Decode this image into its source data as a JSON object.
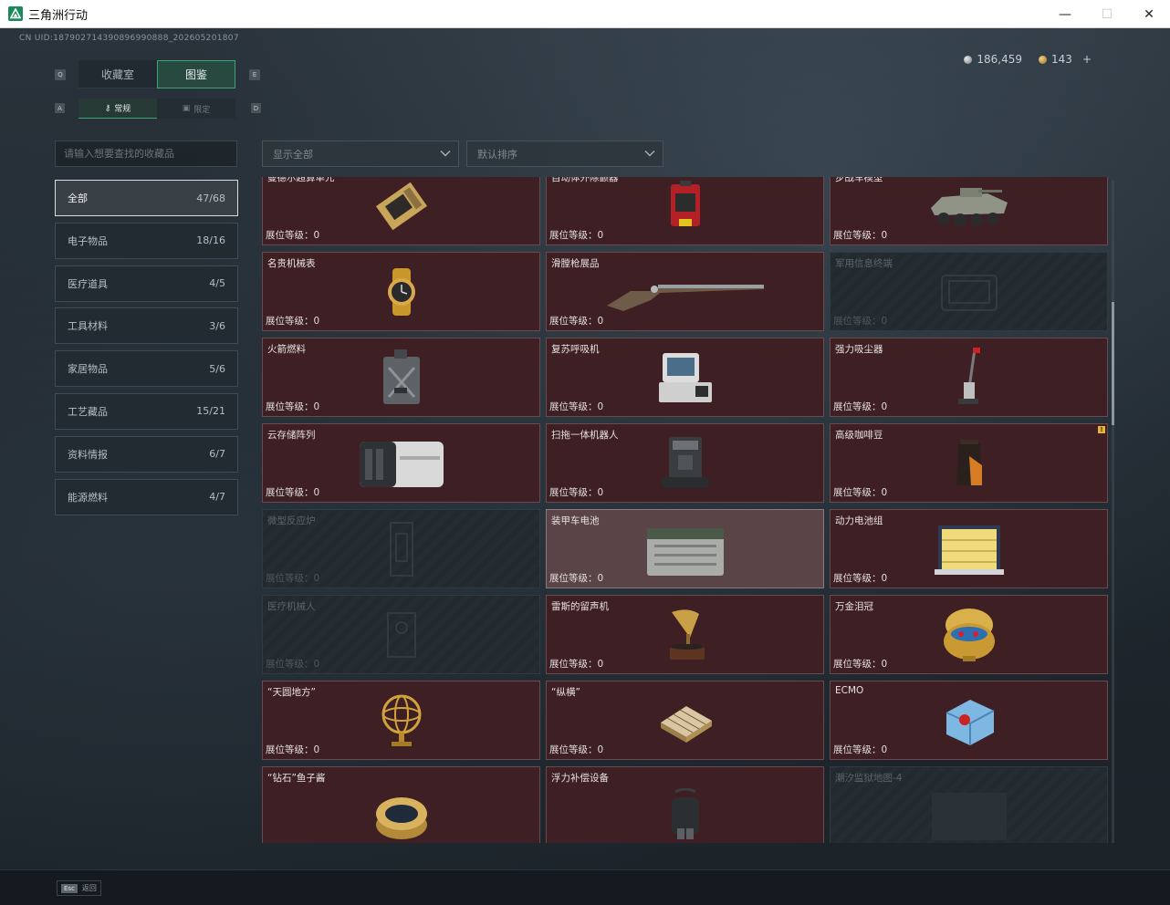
{
  "window": {
    "title": "三角洲行动",
    "minimize": "—",
    "maximize": "☐",
    "close": "✕"
  },
  "uid": "CN UID:187902714390896990888_202605201807",
  "currency": {
    "silver": "186,459",
    "gold": "143",
    "add": "+"
  },
  "keyhints": {
    "tab_prev": "Q",
    "tab_next": "E",
    "sub_prev": "A",
    "sub_next": "D"
  },
  "tabs": [
    {
      "label": "收藏室"
    },
    {
      "label": "图鉴"
    }
  ],
  "subtabs": [
    {
      "label": "常规",
      "icon": "key-icon"
    },
    {
      "label": "限定",
      "icon": "crate-icon"
    }
  ],
  "search": {
    "placeholder": "请输入想要查找的收藏品"
  },
  "filters": {
    "show": "显示全部",
    "sort": "默认排序"
  },
  "categories": [
    {
      "label": "全部",
      "count": "47/68"
    },
    {
      "label": "电子物品",
      "count": "18/16"
    },
    {
      "label": "医疗道具",
      "count": "4/5"
    },
    {
      "label": "工具材料",
      "count": "3/6"
    },
    {
      "label": "家居物品",
      "count": "5/6"
    },
    {
      "label": "工艺藏品",
      "count": "15/21"
    },
    {
      "label": "资料情报",
      "count": "6/7"
    },
    {
      "label": "能源燃料",
      "count": "4/7"
    }
  ],
  "level_label": "展位等级：0",
  "items": [
    {
      "name": "曼德尔超算单元",
      "icon": "gpu-icon",
      "flag": "!"
    },
    {
      "name": "自动体外除颤器",
      "icon": "defibrillator-icon"
    },
    {
      "name": "步战车模型",
      "icon": "ifv-model-icon"
    },
    {
      "name": "名贵机械表",
      "icon": "watch-icon"
    },
    {
      "name": "滑膛枪展品",
      "icon": "musket-icon"
    },
    {
      "name": "军用信息终端",
      "icon": "terminal-icon"
    },
    {
      "name": "火箭燃料",
      "icon": "fuel-can-icon"
    },
    {
      "name": "复苏呼吸机",
      "icon": "ventilator-icon"
    },
    {
      "name": "强力吸尘器",
      "icon": "vacuum-icon"
    },
    {
      "name": "云存储阵列",
      "icon": "storage-array-icon"
    },
    {
      "name": "扫拖一体机器人",
      "icon": "robot-mop-icon"
    },
    {
      "name": "高级咖啡豆",
      "icon": "coffee-bag-icon",
      "flag": "!"
    },
    {
      "name": "微型反应炉",
      "icon": "reactor-icon"
    },
    {
      "name": "装甲车电池",
      "icon": "battery-icon"
    },
    {
      "name": "动力电池组",
      "icon": "battery-pack-icon"
    },
    {
      "name": "医疗机械人",
      "icon": "medical-robot-icon"
    },
    {
      "name": "雷斯的留声机",
      "icon": "gramophone-icon"
    },
    {
      "name": "万金泪冠",
      "icon": "jeweled-egg-icon"
    },
    {
      "name": "“天圆地方”",
      "icon": "armillary-icon"
    },
    {
      "name": "“纵横”",
      "icon": "chessboard-icon"
    },
    {
      "name": "ECMO",
      "icon": "ecmo-icon"
    },
    {
      "name": "“钻石”鱼子酱",
      "icon": "caviar-tin-icon"
    },
    {
      "name": "浮力补偿设备",
      "icon": "bcd-icon"
    },
    {
      "name": "潮汐监狱地图-4",
      "icon": "map-icon"
    }
  ],
  "bottom": {
    "esc_key": "Esc",
    "esc_label": "返回"
  }
}
